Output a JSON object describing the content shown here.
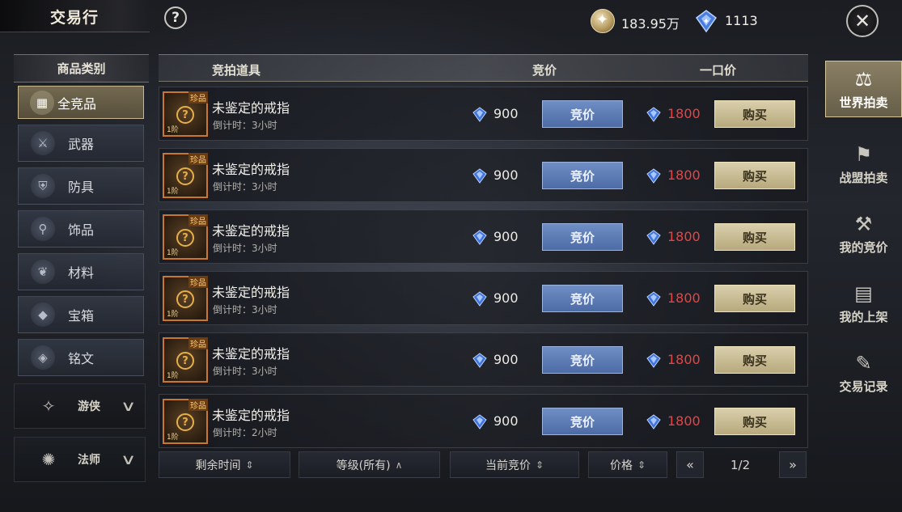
{
  "header": {
    "title": "交易行",
    "help_symbol": "?",
    "gold": "183.95万",
    "diamonds": "1113"
  },
  "categories": {
    "header": "商品类别",
    "items": [
      {
        "label": "全竞品",
        "icon": "grid-icon",
        "active": true
      },
      {
        "label": "武器",
        "icon": "sword-icon",
        "active": false
      },
      {
        "label": "防具",
        "icon": "armor-icon",
        "active": false
      },
      {
        "label": "饰品",
        "icon": "necklace-icon",
        "active": false
      },
      {
        "label": "材料",
        "icon": "leaf-icon",
        "active": false
      },
      {
        "label": "宝箱",
        "icon": "chest-icon",
        "active": false
      },
      {
        "label": "铭文",
        "icon": "book-icon",
        "active": false
      }
    ],
    "classes": [
      {
        "label": "游侠",
        "icon": "ranger-emblem-icon"
      },
      {
        "label": "法师",
        "icon": "mage-emblem-icon"
      }
    ]
  },
  "table": {
    "headers": {
      "item": "竞拍道具",
      "bid": "竞价",
      "buyout": "一口价"
    },
    "rows": [
      {
        "name": "未鉴定的戒指",
        "countdown": "倒计时：3小时",
        "bid_price": "900",
        "bid_label": "竞价",
        "buyout_price": "1800",
        "buy_label": "购买",
        "rarity": "珍品",
        "tier": "1阶"
      },
      {
        "name": "未鉴定的戒指",
        "countdown": "倒计时：3小时",
        "bid_price": "900",
        "bid_label": "竞价",
        "buyout_price": "1800",
        "buy_label": "购买",
        "rarity": "珍品",
        "tier": "1阶"
      },
      {
        "name": "未鉴定的戒指",
        "countdown": "倒计时：3小时",
        "bid_price": "900",
        "bid_label": "竞价",
        "buyout_price": "1800",
        "buy_label": "购买",
        "rarity": "珍品",
        "tier": "1阶"
      },
      {
        "name": "未鉴定的戒指",
        "countdown": "倒计时：3小时",
        "bid_price": "900",
        "bid_label": "竞价",
        "buyout_price": "1800",
        "buy_label": "购买",
        "rarity": "珍品",
        "tier": "1阶"
      },
      {
        "name": "未鉴定的戒指",
        "countdown": "倒计时：3小时",
        "bid_price": "900",
        "bid_label": "竞价",
        "buyout_price": "1800",
        "buy_label": "购买",
        "rarity": "珍品",
        "tier": "1阶"
      },
      {
        "name": "未鉴定的戒指",
        "countdown": "倒计时：2小时",
        "bid_price": "900",
        "bid_label": "竞价",
        "buyout_price": "1800",
        "buy_label": "购买",
        "rarity": "珍品",
        "tier": "1阶"
      }
    ]
  },
  "sort_bar": {
    "time": "剩余时间",
    "level": "等级(所有)",
    "current_bid": "当前竞价",
    "price": "价格",
    "page": "1/2"
  },
  "right_nav": [
    {
      "label": "世界拍卖",
      "icon": "scales-icon",
      "active": true
    },
    {
      "label": "战盟拍卖",
      "icon": "banner-icon",
      "active": false
    },
    {
      "label": "我的竞价",
      "icon": "gavel-icon",
      "active": false
    },
    {
      "label": "我的上架",
      "icon": "shelf-icon",
      "active": false
    },
    {
      "label": "交易记录",
      "icon": "record-icon",
      "active": false
    }
  ],
  "colors": {
    "buyout_price": "#e84444",
    "bid_button": "#5b7ab4",
    "buy_button": "#cbbf95",
    "active_gold": "#8f8262"
  }
}
